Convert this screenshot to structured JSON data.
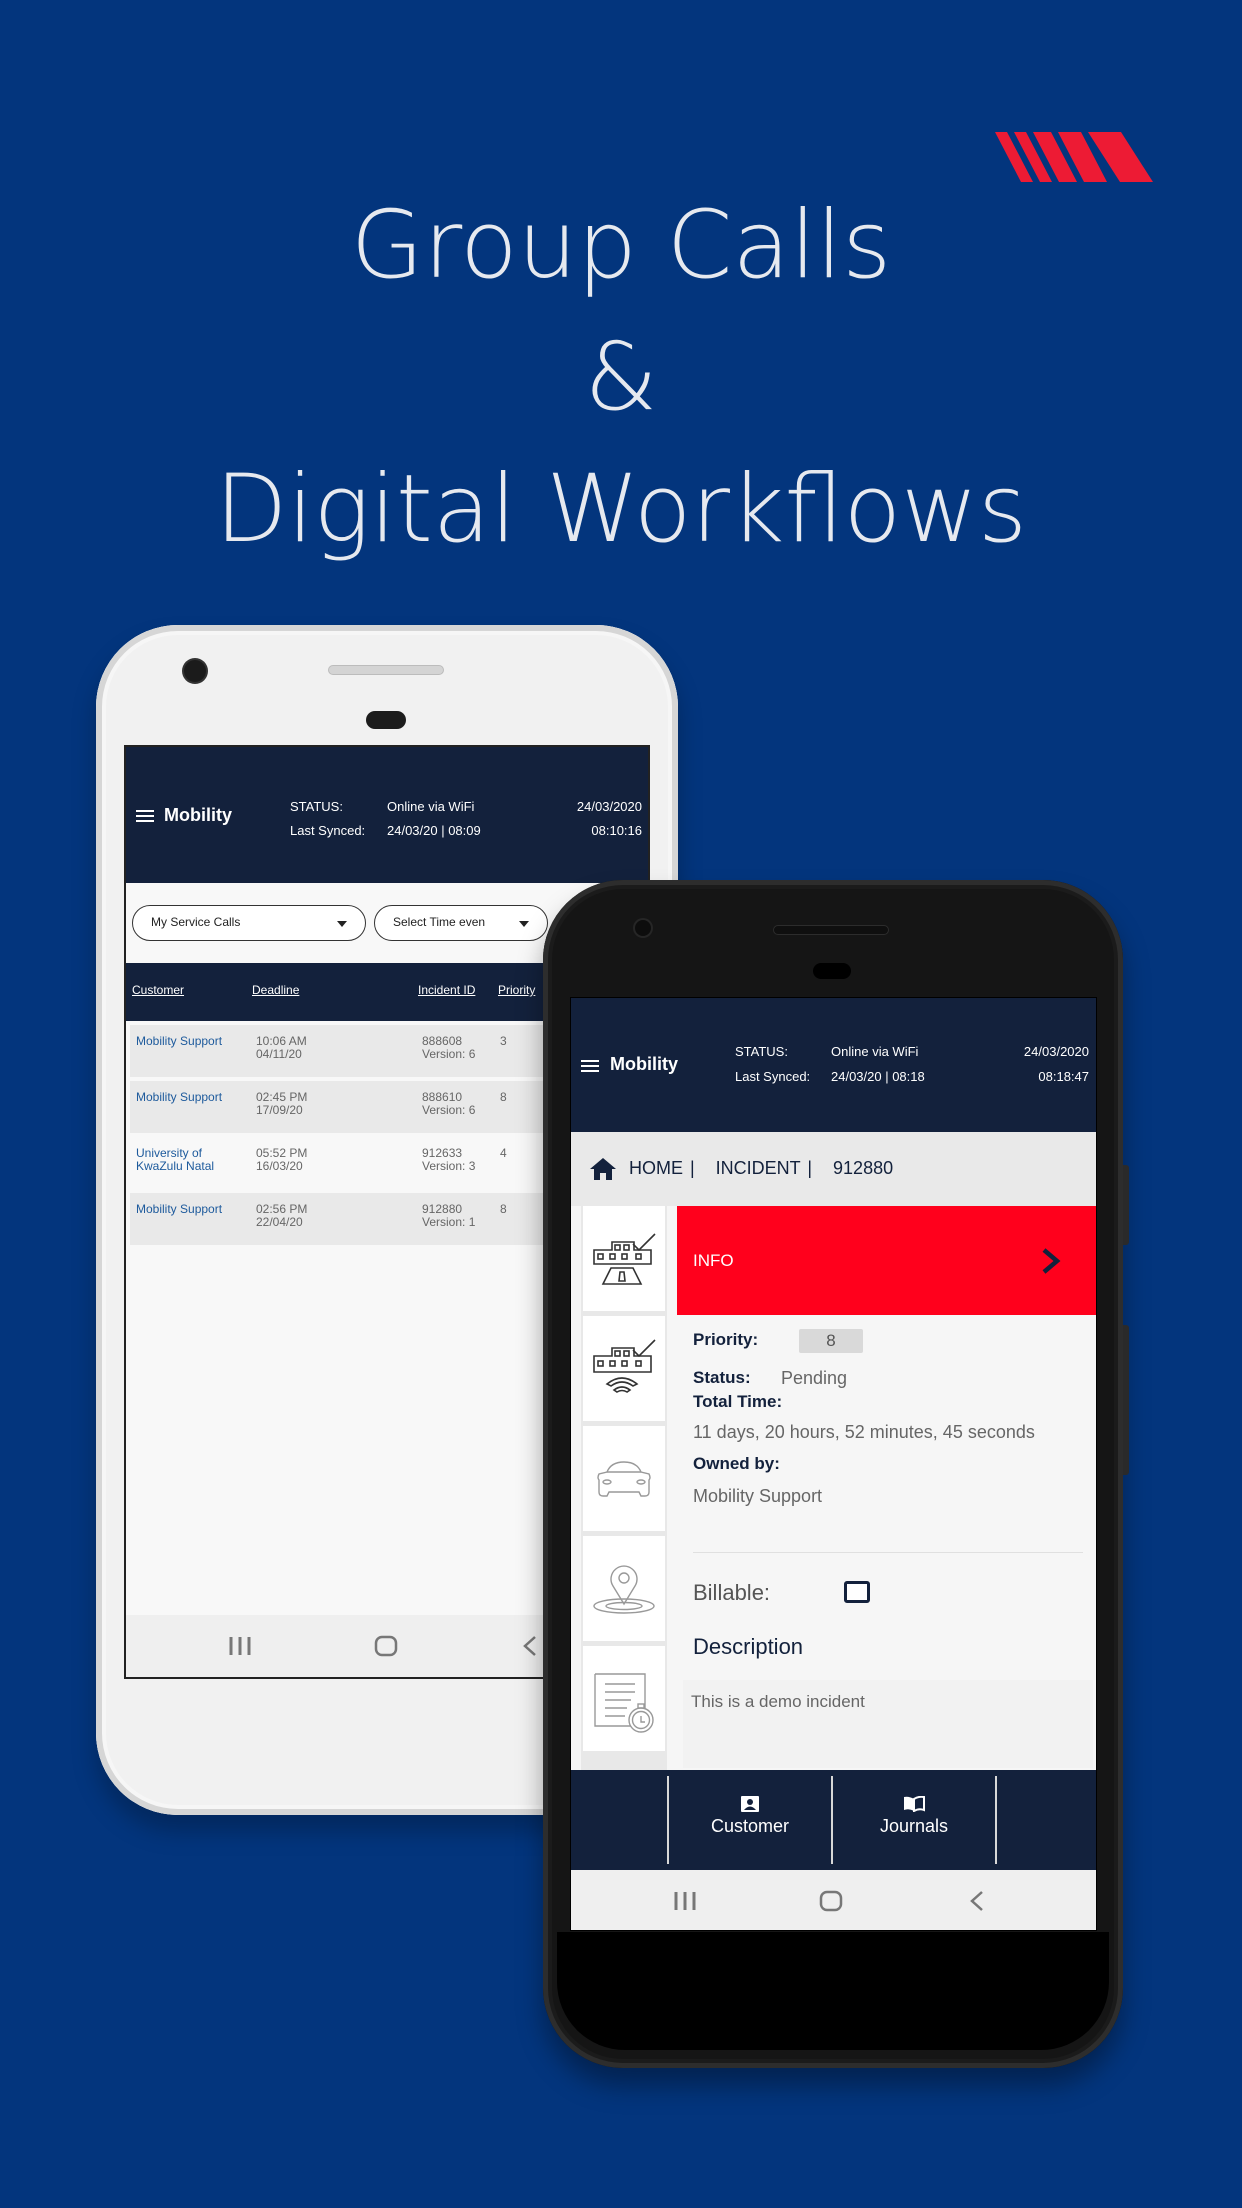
{
  "hero": {
    "lines": [
      "Group Calls",
      "&",
      "Digital Workflows"
    ]
  },
  "colors": {
    "background": "#03357d",
    "brand_navy": "#13213c",
    "accent_red": "#ff001c",
    "logo_red": "#ed1b34",
    "link_blue": "#1d5a9c"
  },
  "logo": {
    "icon": "brand-stripes-logo"
  },
  "phone_list": {
    "header": {
      "menu_icon": "hamburger-icon",
      "brand": "Mobility",
      "status_label": "STATUS:",
      "status_value": "Online via WiFi",
      "synced_label": "Last Synced:",
      "synced_value": "24/03/20 | 08:09",
      "date": "24/03/2020",
      "time": "08:10:16"
    },
    "filters": {
      "calls_select": "My Service Calls",
      "time_select": "Select Time even"
    },
    "table": {
      "columns": [
        "Customer",
        "Deadline",
        "Incident ID",
        "Priority"
      ],
      "rows": [
        {
          "customer": "Mobility Support",
          "deadline_time": "10:06 AM",
          "deadline_date": "04/11/20",
          "incident_id": "888608",
          "version": "Version: 6",
          "priority": "3"
        },
        {
          "customer": "Mobility Support",
          "deadline_time": "02:45 PM",
          "deadline_date": "17/09/20",
          "incident_id": "888610",
          "version": "Version: 6",
          "priority": "8"
        },
        {
          "customer": "University of KwaZulu Natal",
          "deadline_time": "05:52 PM",
          "deadline_date": "16/03/20",
          "incident_id": "912633",
          "version": "Version: 3",
          "priority": "4"
        },
        {
          "customer": "Mobility Support",
          "deadline_time": "02:56 PM",
          "deadline_date": "22/04/20",
          "incident_id": "912880",
          "version": "Version: 1",
          "priority": "8"
        }
      ]
    },
    "navbar": [
      "recent-apps-icon",
      "home-icon",
      "back-icon"
    ]
  },
  "phone_detail": {
    "header": {
      "menu_icon": "hamburger-icon",
      "brand": "Mobility",
      "status_label": "STATUS:",
      "status_value": "Online via WiFi",
      "synced_label": "Last Synced:",
      "synced_value": "24/03/20 | 08:18",
      "date": "24/03/2020",
      "time": "08:18:47"
    },
    "breadcrumb": "HOME |   INCIDENT |   912880",
    "side_icons": [
      "building-road-icon",
      "building-signal-icon",
      "car-icon",
      "location-pin-icon",
      "document-timer-icon"
    ],
    "info_label": "INFO",
    "fields": {
      "priority_label": "Priority:",
      "priority_value": "8",
      "status_label": "Status:",
      "status_value": "Pending",
      "total_time_label": "Total Time:",
      "total_time_value": "11 days, 20 hours, 52 minutes, 45 seconds",
      "owned_by_label": "Owned by:",
      "owned_by_value": "Mobility Support",
      "billable_label": "Billable:",
      "billable_checked": false,
      "description_title": "Description",
      "description_text": "This is a demo incident"
    },
    "tabs": [
      {
        "label": "Customer",
        "icon": "contact-card-icon"
      },
      {
        "label": "Journals",
        "icon": "book-icon"
      }
    ],
    "navbar": [
      "recent-apps-icon",
      "home-icon",
      "back-icon"
    ]
  }
}
